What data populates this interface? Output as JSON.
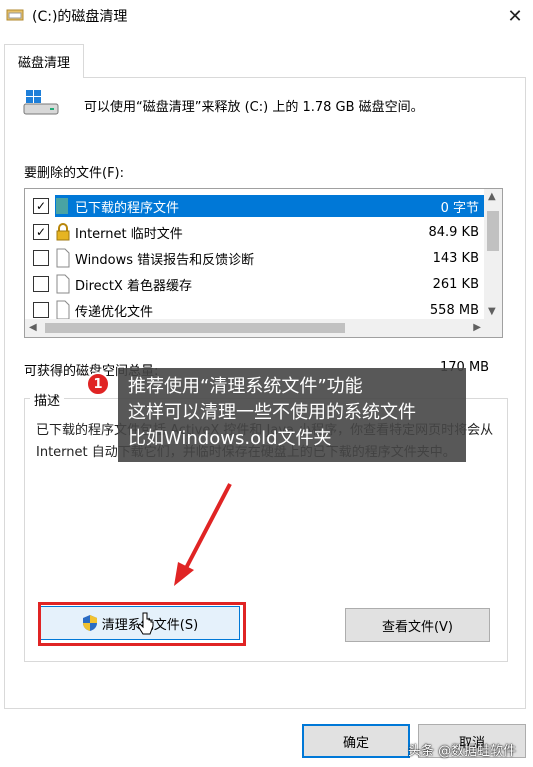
{
  "window": {
    "title": "(C:)的磁盘清理",
    "close_glyph": "✕"
  },
  "tabs": [
    {
      "label": "磁盘清理",
      "active": true
    }
  ],
  "summary": {
    "text": "可以使用“磁盘清理”来释放 (C:) 上的 1.78 GB 磁盘空间。"
  },
  "files": {
    "label": "要删除的文件(F):",
    "items": [
      {
        "checked": true,
        "icon": "folder-icon",
        "name": "已下载的程序文件",
        "size": "0 字节",
        "selected": true
      },
      {
        "checked": true,
        "icon": "lock-icon",
        "name": "Internet 临时文件",
        "size": "84.9 KB",
        "selected": false
      },
      {
        "checked": false,
        "icon": "document-icon",
        "name": "Windows 错误报告和反馈诊断",
        "size": "143 KB",
        "selected": false
      },
      {
        "checked": false,
        "icon": "document-icon",
        "name": "DirectX 着色器缓存",
        "size": "261 KB",
        "selected": false
      },
      {
        "checked": false,
        "icon": "document-icon",
        "name": "传递优化文件",
        "size": "558 MB",
        "selected": false
      }
    ]
  },
  "space": {
    "label": "可获得的磁盘空间总量:",
    "value": "170 MB"
  },
  "description": {
    "title": "描述",
    "text": "已下载的程序文件包括 ActiveX 控件和 Java 小程序，你查看特定网页时将会从 Internet 自动下载它们，并临时保存在硬盘上的已下载的程序文件夹中。"
  },
  "buttons": {
    "clean_system": "清理系统文件(S)",
    "view_files": "查看文件(V)",
    "ok": "确定",
    "cancel": "取消"
  },
  "annotation": {
    "badge": "1",
    "lines": [
      "推荐使用“清理系统文件”功能",
      "这样可以清理一些不使用的系统文件",
      "比如Windows.old文件夹"
    ],
    "color": "#e02424"
  },
  "watermark": "头条 @数据蛙软件",
  "colors": {
    "selection": "#0078d7",
    "accent": "#0078d7"
  }
}
